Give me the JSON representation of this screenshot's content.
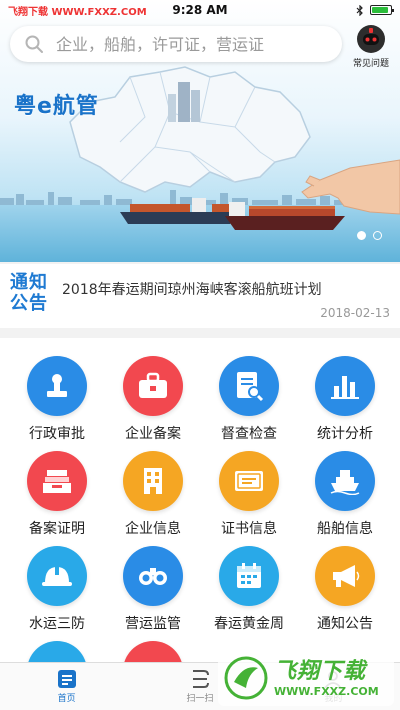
{
  "status_bar": {
    "watermark": "飞翔下载 WWW.FXXZ.COM",
    "time": "9:28 AM",
    "battery_level": 0.9
  },
  "search": {
    "placeholder": "企业，船舶，许可证，营运证"
  },
  "faq": {
    "label": "常见问题"
  },
  "banner": {
    "logo_text": "粤e航管",
    "slide_count": 2,
    "active_slide": 1
  },
  "notice": {
    "badge": "通知公告",
    "title": "2018年春运期间琼州海峡客滚船航班计划",
    "date": "2018-02-13"
  },
  "grid": {
    "items": [
      {
        "label": "行政审批",
        "icon": "stamp-icon",
        "color": "#2a8ce6"
      },
      {
        "label": "企业备案",
        "icon": "briefcase-icon",
        "color": "#f2484f"
      },
      {
        "label": "督查检查",
        "icon": "document-search-icon",
        "color": "#2a8ce6"
      },
      {
        "label": "统计分析",
        "icon": "bar-chart-icon",
        "color": "#2a8ce6"
      },
      {
        "label": "备案证明",
        "icon": "tray-icon",
        "color": "#f2484f"
      },
      {
        "label": "企业信息",
        "icon": "building-icon",
        "color": "#f5a623"
      },
      {
        "label": "证书信息",
        "icon": "certificate-icon",
        "color": "#f5a623"
      },
      {
        "label": "船舶信息",
        "icon": "ship-icon",
        "color": "#2a8ce6"
      },
      {
        "label": "水运三防",
        "icon": "helmet-icon",
        "color": "#29a9e8"
      },
      {
        "label": "营运监管",
        "icon": "binoculars-icon",
        "color": "#2a8ce6"
      },
      {
        "label": "春运黄金周",
        "icon": "calendar-icon",
        "color": "#29a9e8"
      },
      {
        "label": "通知公告",
        "icon": "megaphone-icon",
        "color": "#f5a623"
      }
    ]
  },
  "tabbar": {
    "items": [
      {
        "label": "首页",
        "icon": "home-icon",
        "active": true
      },
      {
        "label": "扫一扫",
        "icon": "scan-icon",
        "active": false
      },
      {
        "label": "我的",
        "icon": "profile-icon",
        "active": false
      }
    ]
  },
  "watermark": {
    "main": "飞翔下载",
    "sub": "WWW.FXXZ.COM"
  },
  "colors": {
    "brand": "#1a73c9",
    "accent_red": "#f2484f",
    "accent_orange": "#f5a623"
  }
}
